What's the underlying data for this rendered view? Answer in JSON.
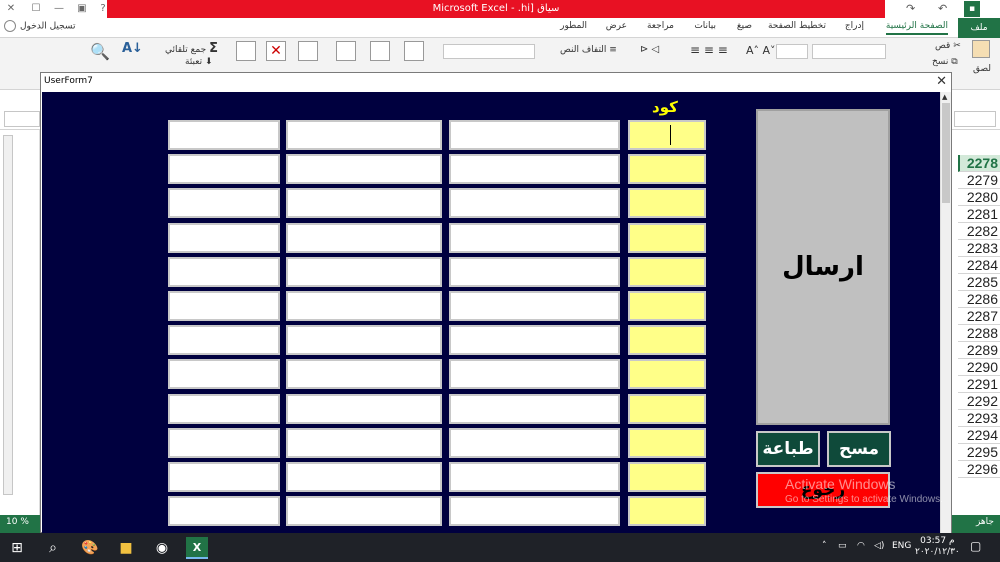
{
  "excel": {
    "title": "Microsoft Excel  - .hi]  سياق",
    "signin": "تسجيل الدخول",
    "tabs": [
      "ملف",
      "الصفحة الرئيسية",
      "إدراج",
      "تخطيط الصفحة",
      "صيغ",
      "بيانات",
      "مراجعة",
      "عرض",
      "المطور"
    ],
    "ribbon": {
      "autosum": "جمع تلقائي",
      "fill": "تعبئة",
      "wrap": "التفاف النص",
      "cut": "قص",
      "copy": "نسخ",
      "paste": "لصق"
    },
    "row_numbers": [
      "2278",
      "2279",
      "2280",
      "2281",
      "2282",
      "2283",
      "2284",
      "2285",
      "2286",
      "2287",
      "2288",
      "2289",
      "2290",
      "2291",
      "2292",
      "2293",
      "2294",
      "2295",
      "2296"
    ],
    "selected_row": "2278",
    "status_zoom": "10 %",
    "status_ready": "جاهز"
  },
  "userform": {
    "title": "UserForm7",
    "code_header": "كود",
    "row_count": 12,
    "buttons": {
      "send": "ارسال",
      "print": "طباعة",
      "clear": "مسح",
      "back": "رجوع"
    }
  },
  "watermark": {
    "line1": "Activate Windows",
    "line2": "Go to Settings to activate Windows."
  },
  "taskbar": {
    "lang": "ENG",
    "time": "03:57 م",
    "date": "٢٠٢٠/١٢/٣٠"
  },
  "colors": {
    "form_background": "#00003f",
    "code_header": "#ffff00",
    "code_field": "#ffff88",
    "button_green": "#0f4a3a",
    "button_red": "#ff0000",
    "excel_green": "#217346",
    "title_red": "#e81123"
  }
}
